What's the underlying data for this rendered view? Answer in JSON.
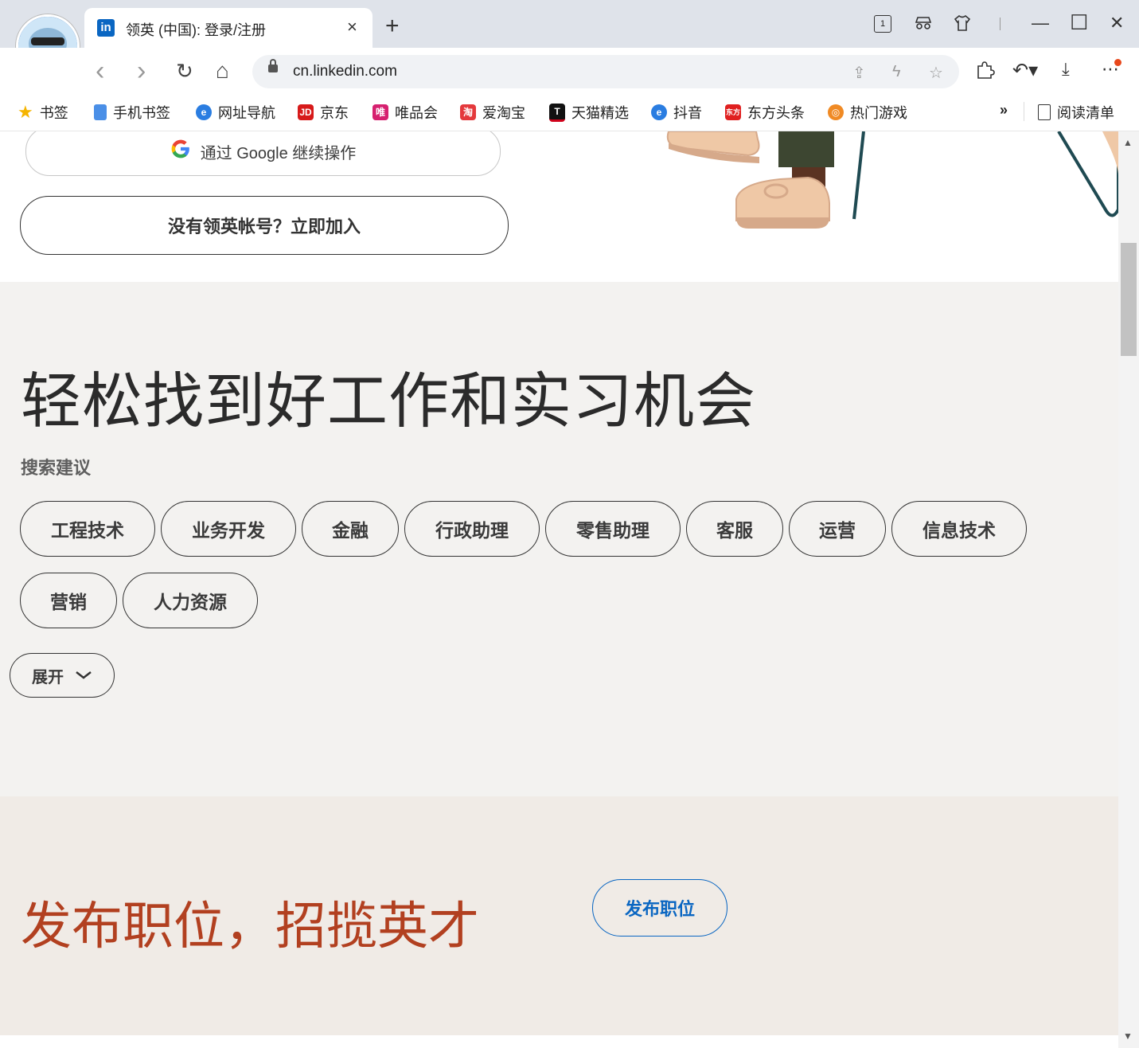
{
  "browser": {
    "tab_title": "领英 (中国): 登录/注册",
    "tab_favicon_text": "in",
    "tab_close": "×",
    "new_tab": "+",
    "url": "cn.linkedin.com",
    "tab_count": "1",
    "window_controls": {
      "minimize": "—",
      "maximize": "☐",
      "close": "✕"
    },
    "nav": {
      "back": "‹",
      "forward": "›",
      "reload": "↻",
      "home": "⌂"
    }
  },
  "bookmarks": {
    "items": [
      {
        "label": "书签",
        "icon": "star-icon",
        "color": "#f5b400"
      },
      {
        "label": "手机书签",
        "icon": "phone-icon",
        "color": "#4a8fe7"
      },
      {
        "label": "网址导航",
        "icon": "e-browser-icon",
        "color": "#2a7de1"
      },
      {
        "label": "京东",
        "icon": "jd-icon",
        "color": "#d71a1a",
        "text": "JD"
      },
      {
        "label": "唯品会",
        "icon": "vip-icon",
        "color": "#d6206f",
        "text": "唯"
      },
      {
        "label": "爱淘宝",
        "icon": "taobao-icon",
        "color": "#e4393c",
        "text": "淘"
      },
      {
        "label": "天猫精选",
        "icon": "tmall-icon",
        "color": "#d0021b",
        "text": "T"
      },
      {
        "label": "抖音",
        "icon": "e-browser-icon",
        "color": "#2a7de1"
      },
      {
        "label": "东方头条",
        "icon": "dftt-icon",
        "color": "#e02020",
        "text": "东方"
      },
      {
        "label": "热门游戏",
        "icon": "game-icon",
        "color": "#f08a24",
        "text": "◎"
      }
    ],
    "more": "»",
    "reading_list": "阅读清单"
  },
  "page": {
    "google_button": "通过 Google 继续操作",
    "join_button": "没有领英帐号？立即加入",
    "jobs_heading": "轻松找到好工作和实习机会",
    "suggestions_label": "搜索建议",
    "suggestions": [
      "工程技术",
      "业务开发",
      "金融",
      "行政助理",
      "零售助理",
      "客服",
      "运营",
      "信息技术",
      "营销",
      "人力资源"
    ],
    "expand_button": "展开",
    "post_heading": "发布职位，招揽英才",
    "post_button": "发布职位"
  },
  "colors": {
    "linkedin_blue": "#0a66c2",
    "post_heading": "#b24020",
    "section_bg": "#f3f2f0",
    "post_section_bg": "#f0ebe6"
  }
}
